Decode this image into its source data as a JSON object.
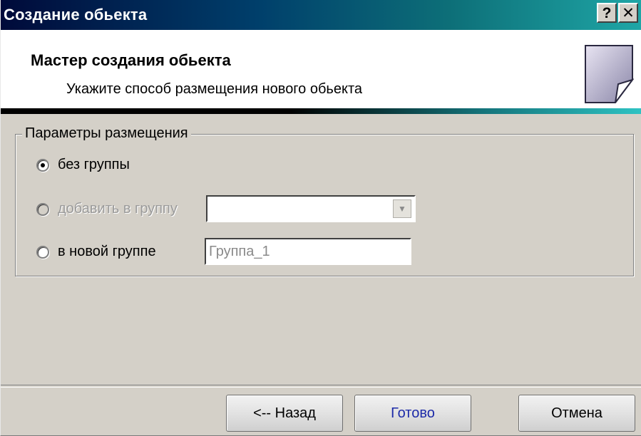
{
  "window": {
    "title": "Создание обьекта",
    "help_label": "?",
    "close_label": "✕"
  },
  "header": {
    "title": "Мастер создания обьекта",
    "subtitle": "Укажите способ размещения нового обьекта",
    "icon": "wizard-page-icon"
  },
  "placement": {
    "group_label": "Параметры размещения",
    "options": [
      {
        "label": "без группы",
        "checked": true,
        "enabled": true
      },
      {
        "label": "добавить в группу",
        "checked": false,
        "enabled": false
      },
      {
        "label": "в новой группе",
        "checked": false,
        "enabled": true
      }
    ],
    "existing_group_value": "",
    "new_group_value": "Группа_1"
  },
  "buttons": {
    "back": "<-- Назад",
    "finish": "Готово",
    "cancel": "Отмена"
  },
  "colors": {
    "titlebar_start": "#000a3a",
    "titlebar_end": "#1fa6a6",
    "dialog_bg": "#d4d0c8",
    "finish_text": "#1c2aa8"
  }
}
